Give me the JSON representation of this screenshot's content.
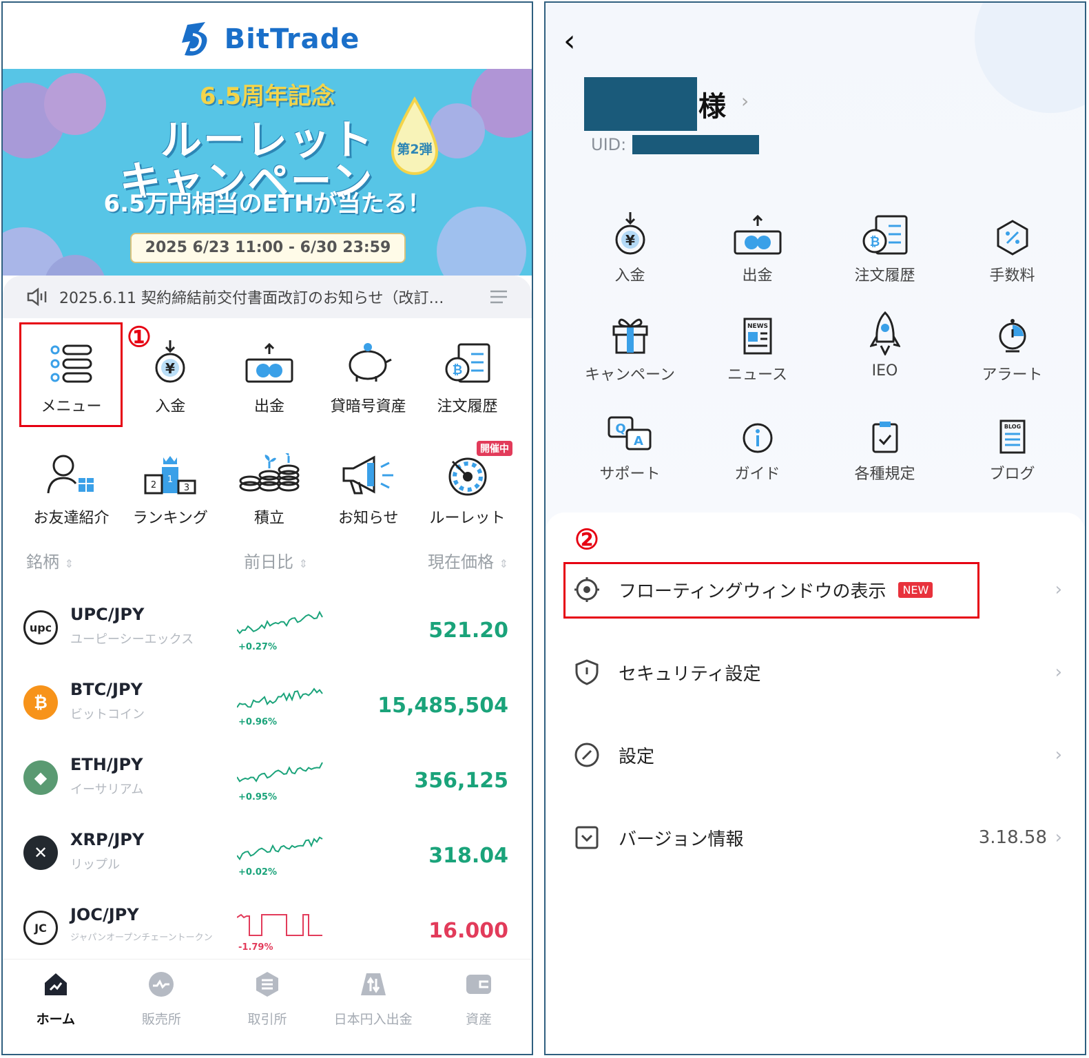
{
  "left": {
    "logo": "BitTrade",
    "banner": {
      "anniversary": "6.5周年記念",
      "title_line1": "ルーレット",
      "title_line2": "キャンペーン",
      "round": "第2弾",
      "prize": "6.5万円相当のETHが当たる！",
      "dates": "2025 6/23 11:00 - 6/30 23:59"
    },
    "notice": "2025.6.11 契約締結前交付書面改訂のお知らせ（改訂…",
    "annotation1": "①",
    "grid_row1": [
      {
        "label": "メニュー",
        "icon": "menu-list-icon"
      },
      {
        "label": "入金",
        "icon": "deposit-icon"
      },
      {
        "label": "出金",
        "icon": "withdraw-icon"
      },
      {
        "label": "貸暗号資産",
        "icon": "piggy-bank-icon"
      },
      {
        "label": "注文履歴",
        "icon": "order-history-icon"
      }
    ],
    "grid_row2": [
      {
        "label": "お友達紹介",
        "icon": "referral-icon"
      },
      {
        "label": "ランキング",
        "icon": "ranking-podium-icon"
      },
      {
        "label": "積立",
        "icon": "coin-stack-icon"
      },
      {
        "label": "お知らせ",
        "icon": "megaphone-icon"
      },
      {
        "label": "ルーレット",
        "icon": "roulette-icon",
        "badge": "開催中"
      }
    ],
    "list_header": {
      "name": "銘柄",
      "change": "前日比",
      "price": "現在価格"
    },
    "coins": [
      {
        "pair": "UPC/JPY",
        "name": "ユーピーシーエックス",
        "pct": "+0.27%",
        "price": "521.20",
        "trend": "up",
        "icon_text": "upc",
        "icon_color": "#ffffff"
      },
      {
        "pair": "BTC/JPY",
        "name": "ビットコイン",
        "pct": "+0.96%",
        "price": "15,485,504",
        "trend": "up",
        "icon_text": "₿",
        "icon_color": "#f7931a"
      },
      {
        "pair": "ETH/JPY",
        "name": "イーサリアム",
        "pct": "+0.95%",
        "price": "356,125",
        "trend": "up",
        "icon_text": "◆",
        "icon_color": "#5a9a72"
      },
      {
        "pair": "XRP/JPY",
        "name": "リップル",
        "pct": "+0.02%",
        "price": "318.04",
        "trend": "up",
        "icon_text": "✕",
        "icon_color": "#23292f"
      },
      {
        "pair": "JOC/JPY",
        "name": "ジャパンオープンチェーントークン",
        "pct": "-1.79%",
        "price": "16.000",
        "trend": "down",
        "icon_text": "JC",
        "icon_color": "#ffffff"
      }
    ],
    "tabs": [
      {
        "label": "ホーム",
        "icon": "home-icon",
        "active": true
      },
      {
        "label": "販売所",
        "icon": "exchange-shop-icon",
        "active": false
      },
      {
        "label": "取引所",
        "icon": "trading-icon",
        "active": false
      },
      {
        "label": "日本円入出金",
        "icon": "yen-transfer-icon",
        "active": false
      },
      {
        "label": "資産",
        "icon": "wallet-icon",
        "active": false
      }
    ],
    "colors": {
      "up": "#1aa37a",
      "down": "#e23b5a",
      "accent": "#1a6fc9",
      "highlight": "#e60012"
    }
  },
  "right": {
    "honorific": "様",
    "uid_label": "UID:",
    "grid_row1": [
      {
        "label": "入金",
        "icon": "deposit-icon"
      },
      {
        "label": "出金",
        "icon": "withdraw-icon"
      },
      {
        "label": "注文履歴",
        "icon": "order-history-icon"
      },
      {
        "label": "手数料",
        "icon": "fee-icon"
      }
    ],
    "grid_row2": [
      {
        "label": "キャンペーン",
        "icon": "gift-icon"
      },
      {
        "label": "ニュース",
        "icon": "news-icon"
      },
      {
        "label": "IEO",
        "icon": "rocket-icon"
      },
      {
        "label": "アラート",
        "icon": "alarm-icon"
      }
    ],
    "grid_row3": [
      {
        "label": "サポート",
        "icon": "support-qa-icon"
      },
      {
        "label": "ガイド",
        "icon": "info-icon"
      },
      {
        "label": "各種規定",
        "icon": "rules-clipboard-icon"
      },
      {
        "label": "ブログ",
        "icon": "blog-icon"
      }
    ],
    "annotation2": "②",
    "menu": [
      {
        "label": "フローティングウィンドウの表示",
        "badge": "NEW",
        "icon": "target-icon"
      },
      {
        "label": "セキュリティ設定",
        "icon": "shield-icon"
      },
      {
        "label": "設定",
        "icon": "settings-compass-icon"
      },
      {
        "label": "バージョン情報",
        "value": "3.18.58",
        "icon": "version-icon"
      }
    ]
  }
}
